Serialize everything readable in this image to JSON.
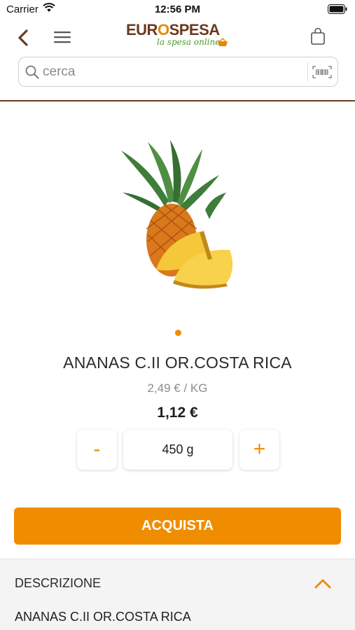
{
  "status_bar": {
    "carrier": "Carrier",
    "time": "12:56 PM"
  },
  "header": {
    "logo_text_left": "EUR",
    "logo_text_o": "O",
    "logo_text_right": "SPESA",
    "logo_tagline": "la spesa online",
    "icons": [
      "back-chevron-icon",
      "hamburger-menu-icon",
      "shopping-bag-icon"
    ]
  },
  "search": {
    "placeholder": "cerca",
    "value": ""
  },
  "product": {
    "title": "ANANAS C.II OR.COSTA RICA",
    "unit_price": "2,49 € / KG",
    "total_price": "1,12 €",
    "quantity": "450 g",
    "minus_label": "-",
    "plus_label": "+",
    "buy_label": "ACQUISTA"
  },
  "gallery": {
    "current_page": 1,
    "total_pages": 1
  },
  "description": {
    "header": "DESCRIZIONE",
    "text": "ANANAS C.II OR.COSTA RICA"
  },
  "colors": {
    "accent": "#f08c00",
    "brand_brown": "#6b3a1f",
    "brand_green": "#4c9a2a"
  }
}
